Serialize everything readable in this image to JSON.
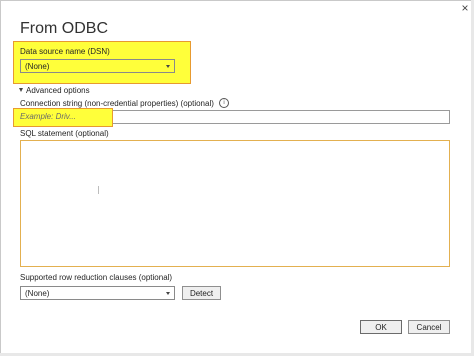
{
  "dialog": {
    "title": "From ODBC",
    "close_glyph": "×"
  },
  "dsn": {
    "label": "Data source name (DSN)",
    "selected": "(None)",
    "highlight_color": "#ffff3a"
  },
  "advanced": {
    "label": "Advanced options",
    "expanded": true
  },
  "connection_string": {
    "label": "Connection string (non-credential properties) (optional)",
    "info_glyph": "i",
    "placeholder": "Example: Driv..."
  },
  "sql": {
    "label": "SQL statement (optional)",
    "value": ""
  },
  "row_reduction": {
    "label": "Supported row reduction clauses (optional)",
    "selected": "(None)"
  },
  "buttons": {
    "detect": "Detect",
    "ok": "OK",
    "cancel": "Cancel"
  },
  "colors": {
    "highlight": "#ffff3a",
    "highlight_border": "#e79a30",
    "sql_border": "#e3b050"
  }
}
